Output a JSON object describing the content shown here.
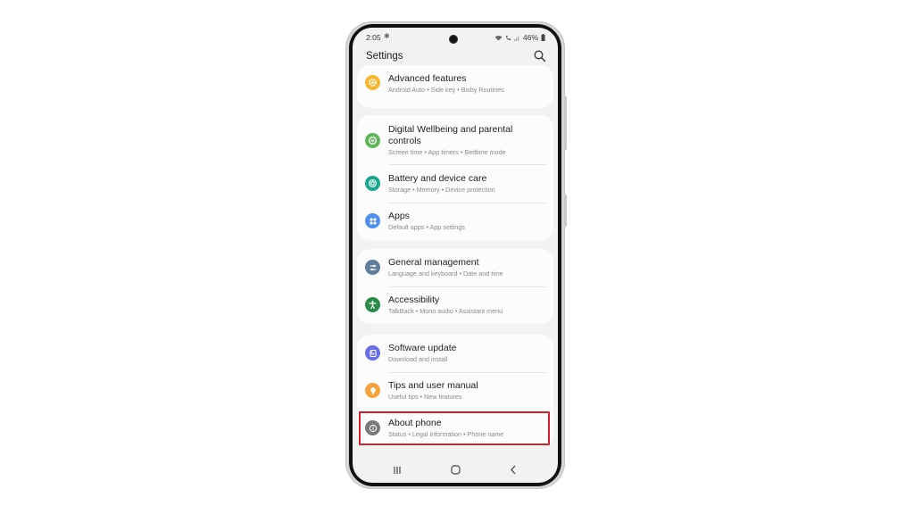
{
  "status_bar": {
    "time": "2:05",
    "battery": "46%"
  },
  "header": {
    "title": "Settings",
    "search_icon": "search-icon"
  },
  "cards": [
    {
      "items": [
        {
          "label": "Advanced features",
          "sub": "Android Auto  •  Side key  •  Bixby Routines",
          "icon": "gear-icon",
          "color": "#f5b731"
        }
      ]
    },
    {
      "items": [
        {
          "label": "Digital Wellbeing and parental controls",
          "sub": "Screen time  •  App timers  •  Bedtime mode",
          "icon": "wellbeing-icon",
          "color": "#5fb65b"
        },
        {
          "label": "Battery and device care",
          "sub": "Storage  •  Memory  •  Device protection",
          "icon": "device-care-icon",
          "color": "#17a88f"
        },
        {
          "label": "Apps",
          "sub": "Default apps  •  App settings",
          "icon": "apps-grid-icon",
          "color": "#4f8ff0"
        }
      ]
    },
    {
      "items": [
        {
          "label": "General management",
          "sub": "Language and keyboard  •  Date and time",
          "icon": "sliders-icon",
          "color": "#5e7d9a"
        },
        {
          "label": "Accessibility",
          "sub": "TalkBack  •  Mono audio  •  Assistant menu",
          "icon": "accessibility-icon",
          "color": "#2a8a4a"
        }
      ]
    },
    {
      "items": [
        {
          "label": "Software update",
          "sub": "Download and install",
          "icon": "software-update-icon",
          "color": "#6a6de8"
        },
        {
          "label": "Tips and user manual",
          "sub": "Useful tips  •  New features",
          "icon": "lightbulb-icon",
          "color": "#f5a23c"
        },
        {
          "label": "About phone",
          "sub": "Status  •  Legal information  •  Phone name",
          "icon": "info-icon",
          "color": "#7a7a7a",
          "highlighted": true
        }
      ]
    }
  ],
  "highlight_color": "#d8202a",
  "nav_bar": {
    "recents": "recents-icon",
    "home": "home-icon",
    "back": "back-icon"
  }
}
